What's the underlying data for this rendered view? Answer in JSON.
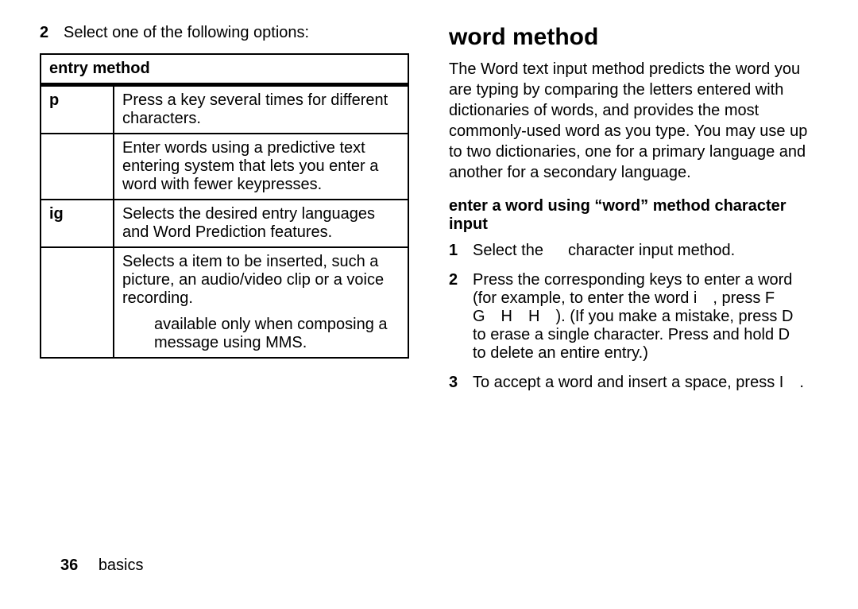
{
  "left": {
    "step2_num": "2",
    "step2_text": "Select one of the following options:",
    "table_header": "entry method",
    "rows": [
      {
        "key": "p",
        "desc": "Press a key several times for different characters."
      },
      {
        "key": "",
        "desc": "Enter words using a predictive text entering system that lets you enter a word with fewer keypresses."
      },
      {
        "key": "ig",
        "desc": "Selects the desired entry languages and Word Prediction features."
      },
      {
        "key": "",
        "desc": "Selects a item to be inserted, such a picture, an audio/video clip or a voice recording.",
        "note": "available only when composing a message using MMS."
      }
    ]
  },
  "right": {
    "heading": "word method",
    "intro": "The Word text input method predicts the word you are typing by comparing the letters entered with dictionaries of words, and provides the most commonly-used word as you type. You may use up to two dictionaries, one for a primary language and another for a secondary language.",
    "subhead": "enter a word using “word” method character input",
    "steps": [
      {
        "num": "1",
        "text": "Select the   character input method."
      },
      {
        "num": "2",
        "text": "Press the corresponding keys to enter a word (for example, to enter the word i , press F G H H ). (If you make a mistake, press D  to erase a single character. Press and hold D  to delete an entire entry.)"
      },
      {
        "num": "3",
        "text": "To accept a word and insert a space, press I ."
      }
    ]
  },
  "footer": {
    "num": "36",
    "section": "basics"
  }
}
